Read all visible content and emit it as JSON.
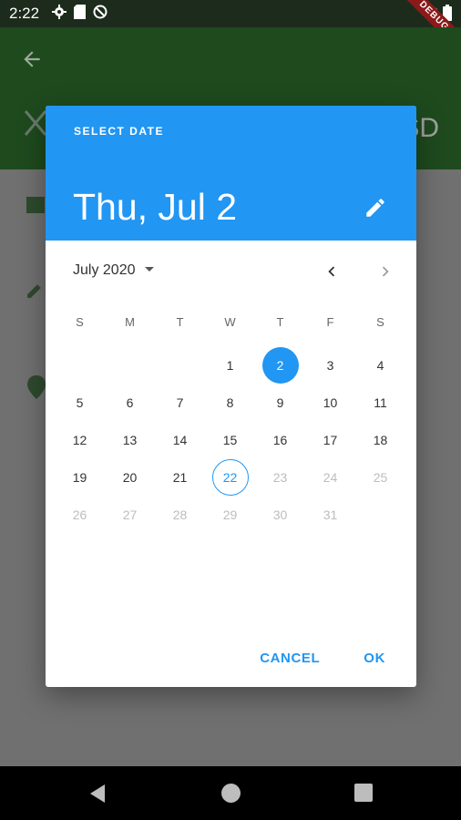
{
  "status_bar": {
    "time": "2:22",
    "banner": "DEBUG"
  },
  "app": {
    "title_partial": "SD"
  },
  "dialog": {
    "overline": "SELECT DATE",
    "selected_date": "Thu, Jul 2",
    "month_label": "July 2020",
    "weekdays": [
      "S",
      "M",
      "T",
      "W",
      "T",
      "F",
      "S"
    ],
    "days": [
      {
        "label": "",
        "state": "empty"
      },
      {
        "label": "",
        "state": "empty"
      },
      {
        "label": "",
        "state": "empty"
      },
      {
        "label": "1",
        "state": "normal"
      },
      {
        "label": "2",
        "state": "selected"
      },
      {
        "label": "3",
        "state": "normal"
      },
      {
        "label": "4",
        "state": "normal"
      },
      {
        "label": "5",
        "state": "normal"
      },
      {
        "label": "6",
        "state": "normal"
      },
      {
        "label": "7",
        "state": "normal"
      },
      {
        "label": "8",
        "state": "normal"
      },
      {
        "label": "9",
        "state": "normal"
      },
      {
        "label": "10",
        "state": "normal"
      },
      {
        "label": "11",
        "state": "normal"
      },
      {
        "label": "12",
        "state": "normal"
      },
      {
        "label": "13",
        "state": "normal"
      },
      {
        "label": "14",
        "state": "normal"
      },
      {
        "label": "15",
        "state": "normal"
      },
      {
        "label": "16",
        "state": "normal"
      },
      {
        "label": "17",
        "state": "normal"
      },
      {
        "label": "18",
        "state": "normal"
      },
      {
        "label": "19",
        "state": "normal"
      },
      {
        "label": "20",
        "state": "normal"
      },
      {
        "label": "21",
        "state": "normal"
      },
      {
        "label": "22",
        "state": "today"
      },
      {
        "label": "23",
        "state": "disabled"
      },
      {
        "label": "24",
        "state": "disabled"
      },
      {
        "label": "25",
        "state": "disabled"
      },
      {
        "label": "26",
        "state": "disabled"
      },
      {
        "label": "27",
        "state": "disabled"
      },
      {
        "label": "28",
        "state": "disabled"
      },
      {
        "label": "29",
        "state": "disabled"
      },
      {
        "label": "30",
        "state": "disabled"
      },
      {
        "label": "31",
        "state": "disabled"
      }
    ],
    "cancel_label": "CANCEL",
    "ok_label": "OK"
  },
  "icons": {
    "settings": "gear-icon",
    "sd_card": "sd-card-icon",
    "no_sync": "do-not-disturb-icon",
    "wifi": "wifi-icon",
    "battery": "battery-icon",
    "back": "arrow-back-icon",
    "edit": "pencil-icon",
    "dropdown": "arrow-drop-down-icon",
    "prev": "chevron-left-icon",
    "next": "chevron-right-icon"
  },
  "colors": {
    "accent": "#2196f3",
    "app_bar": "#2e7d32"
  }
}
